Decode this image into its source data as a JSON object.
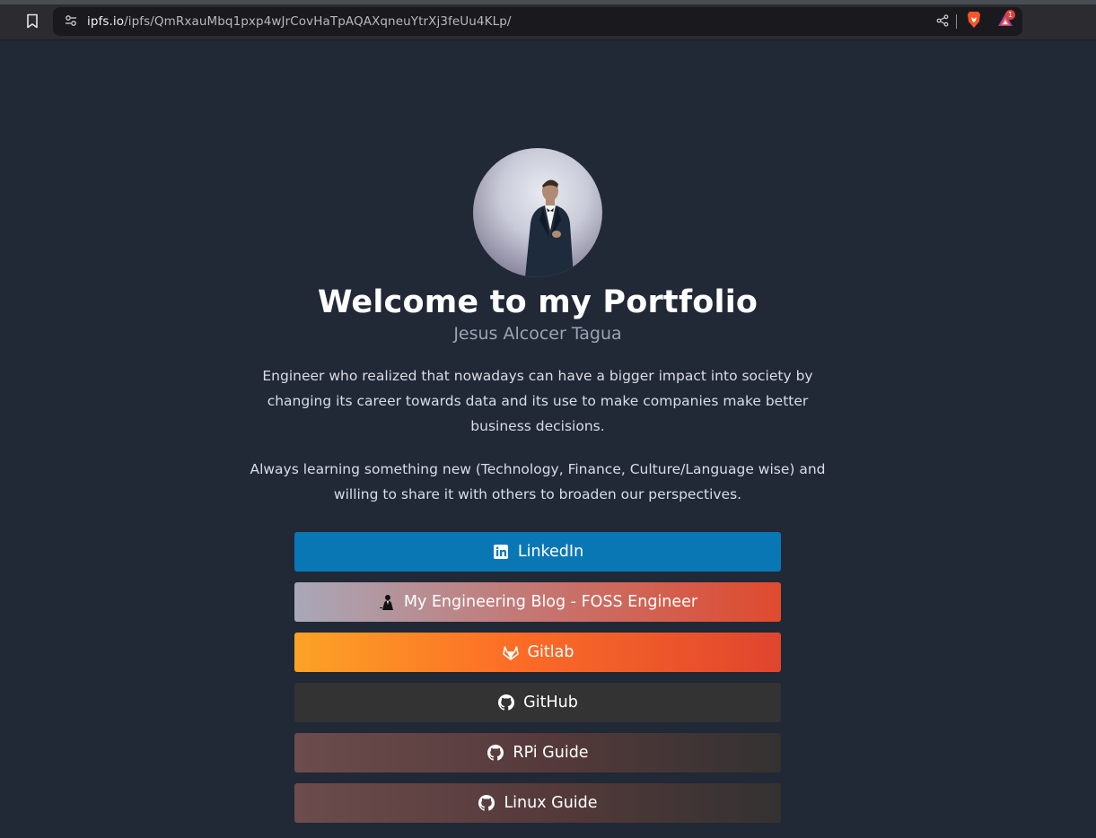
{
  "browser": {
    "url_host": "ipfs.io",
    "url_path": "/ipfs/QmRxauMbq1pxp4wJrCovHaTpAQAXqneuYtrXj3feUu4KLp/",
    "rewards_badge": "1",
    "icons": [
      "bookmark-icon",
      "site-info-icon",
      "share-icon",
      "brave-lion-icon",
      "brave-rewards-icon"
    ]
  },
  "profile": {
    "title": "Welcome to my Portfolio",
    "name": "Jesus Alcocer Tagua",
    "bio": [
      "Engineer who realized that nowadays can have a bigger impact into society by changing its career towards data and its use to make companies make better business decisions.",
      "Always learning something new (Technology, Finance, Culture/Language wise) and willing to share it with others to broaden our perspectives."
    ]
  },
  "links": {
    "linkedin": "LinkedIn",
    "blog": "My Engineering Blog - FOSS Engineer",
    "gitlab": "Gitlab",
    "github": "GitHub",
    "rpi": "RPi Guide",
    "linux": "Linux Guide"
  },
  "colors": {
    "page_bg": "#212836",
    "linkedin": "#0a77b5",
    "github": "#333333",
    "gitlab_orange": "#fc6d26"
  }
}
